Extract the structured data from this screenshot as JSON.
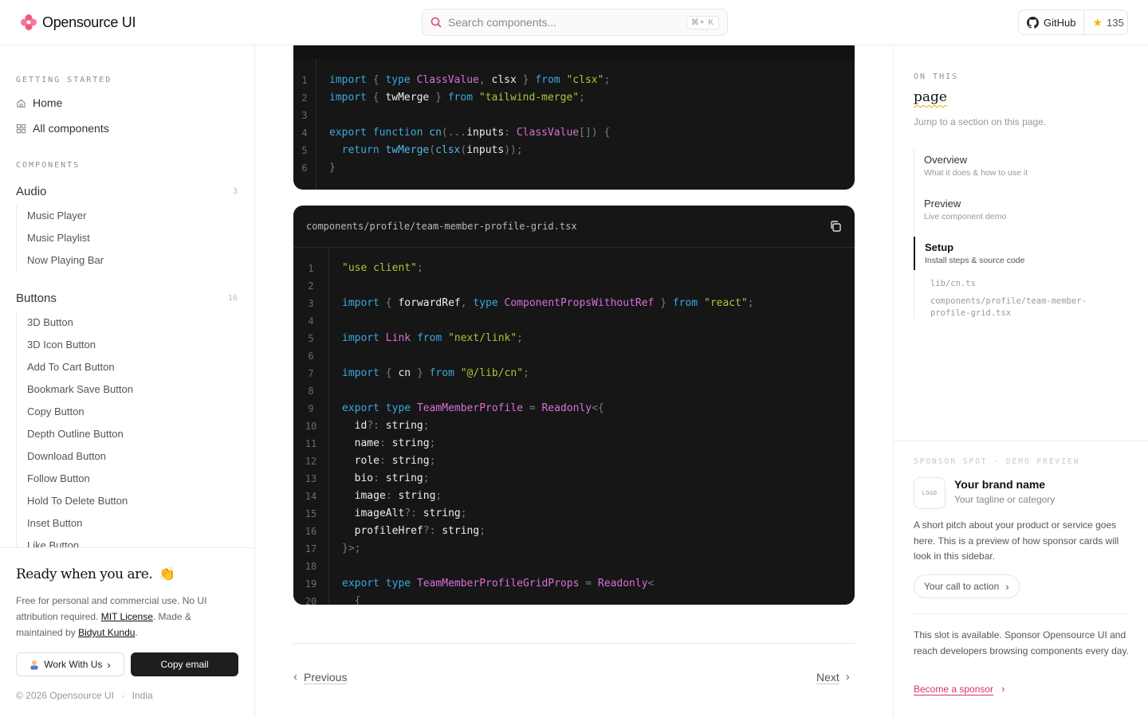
{
  "header": {
    "brand": "Opensource UI",
    "search_placeholder": "Search components...",
    "shortcut": "⌘+ K",
    "github_label": "GitHub",
    "stars": "135"
  },
  "sidebar": {
    "getting_started_label": "GETTING STARTED",
    "home": "Home",
    "all_components": "All components",
    "components_label": "COMPONENTS",
    "groups": [
      {
        "name": "Audio",
        "count": "3",
        "items": [
          "Music Player",
          "Music Playlist",
          "Now Playing Bar"
        ]
      },
      {
        "name": "Buttons",
        "count": "16",
        "items": [
          "3D Button",
          "3D Icon Button",
          "Add To Cart Button",
          "Bookmark Save Button",
          "Copy Button",
          "Depth Outline Button",
          "Download Button",
          "Follow Button",
          "Hold To Delete Button",
          "Inset Button",
          "Like Button"
        ]
      }
    ],
    "footer": {
      "ready": "Ready when you are.",
      "ready_emoji": "👏",
      "license_pre": "Free for personal and commercial use. No UI attribution required.",
      "license_link": "MIT License",
      "license_mid": ". Made & maintained by",
      "author": "Bidyut Kundu",
      "work_label": "Work With Us",
      "email_label": "Copy email",
      "copyright": "© 2026 Opensource UI",
      "country": "India"
    }
  },
  "code_block_1": {
    "line_numbers": [
      "1",
      "2",
      "3",
      "4",
      "5",
      "6"
    ]
  },
  "code_block_2": {
    "filename": "components/profile/team-member-profile-grid.tsx",
    "line_numbers": [
      "1",
      "2",
      "3",
      "4",
      "5",
      "6",
      "7",
      "8",
      "9",
      "10",
      "11",
      "12",
      "13",
      "14",
      "15",
      "16",
      "17",
      "18",
      "19",
      "20"
    ]
  },
  "pager": {
    "previous": "Previous",
    "next": "Next"
  },
  "toc": {
    "label": "ON THIS",
    "title": "page",
    "subtitle": "Jump to a section on this page.",
    "items": [
      {
        "title": "Overview",
        "sub": "What it does & how to use it"
      },
      {
        "title": "Preview",
        "sub": "Live component demo"
      },
      {
        "title": "Setup",
        "sub": "Install steps & source code"
      }
    ],
    "files": [
      "lib/cn.ts",
      "components/profile/team-member-profile-grid.tsx"
    ]
  },
  "sponsor": {
    "label": "SPONSOR SPOT · DEMO PREVIEW",
    "logo": "LOGO",
    "brand_name": "Your brand name",
    "tagline": "Your tagline or category",
    "pitch": "A short pitch about your product or service goes here. This is a preview of how sponsor cards will look in this sidebar.",
    "cta": "Your call to action",
    "slot_text": "This slot is available. Sponsor Opensource UI and reach developers browsing components every day.",
    "become": "Become a sponsor"
  },
  "colors": {
    "accent": "#d6336c",
    "code_bg": "#161616",
    "keyword": "#3aa8e0",
    "type": "#d86fd8",
    "string": "#a3c93a"
  }
}
